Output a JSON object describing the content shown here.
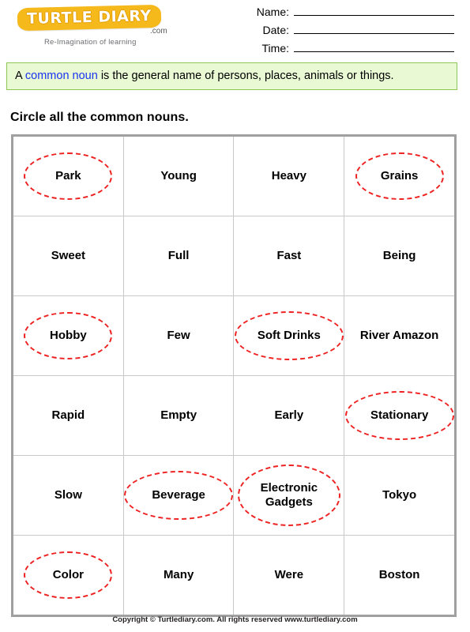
{
  "brand": {
    "logo_text": "TURTLE DIARY",
    "logo_suffix": ".com",
    "tagline": "Re-Imagination of learning",
    "badge_color": "#f6b91b",
    "badge_outline_color": "#e39c00"
  },
  "header_fields": [
    {
      "label": "Name:"
    },
    {
      "label": "Date:"
    },
    {
      "label": "Time:"
    }
  ],
  "definition": {
    "lead": "A ",
    "keyword": "common noun",
    "rest": " is the general name of persons, places, animals or things.",
    "keyword_color": "#1a33f0",
    "background_color": "#e9f9d4",
    "border_color": "#8fc656"
  },
  "instruction": {
    "text": "Circle all the common nouns."
  },
  "grid": {
    "columns": 4,
    "rows": 6,
    "circle_color": "#ee2222",
    "border_color": "#a0a0a0",
    "cells": [
      [
        {
          "word": "Park",
          "circled": true,
          "shape": "one-line"
        },
        {
          "word": "Young",
          "circled": false,
          "shape": "one-line"
        },
        {
          "word": "Heavy",
          "circled": false,
          "shape": "one-line"
        },
        {
          "word": "Grains",
          "circled": true,
          "shape": "one-line"
        }
      ],
      [
        {
          "word": "Sweet",
          "circled": false,
          "shape": "one-line"
        },
        {
          "word": "Full",
          "circled": false,
          "shape": "one-line"
        },
        {
          "word": "Fast",
          "circled": false,
          "shape": "one-line"
        },
        {
          "word": "Being",
          "circled": false,
          "shape": "one-line"
        }
      ],
      [
        {
          "word": "Hobby",
          "circled": true,
          "shape": "one-line"
        },
        {
          "word": "Few",
          "circled": false,
          "shape": "one-line"
        },
        {
          "word": "Soft Drinks",
          "circled": true,
          "shape": "wide"
        },
        {
          "word": "River Amazon",
          "circled": false,
          "shape": "one-line"
        }
      ],
      [
        {
          "word": "Rapid",
          "circled": false,
          "shape": "one-line"
        },
        {
          "word": "Empty",
          "circled": false,
          "shape": "one-line"
        },
        {
          "word": "Early",
          "circled": false,
          "shape": "one-line"
        },
        {
          "word": "Stationary",
          "circled": true,
          "shape": "wide"
        }
      ],
      [
        {
          "word": "Slow",
          "circled": false,
          "shape": "one-line"
        },
        {
          "word": "Beverage",
          "circled": true,
          "shape": "wide"
        },
        {
          "word": "Electronic\nGadgets",
          "circled": true,
          "shape": "two-line"
        },
        {
          "word": "Tokyo",
          "circled": false,
          "shape": "one-line"
        }
      ],
      [
        {
          "word": "Color",
          "circled": true,
          "shape": "one-line"
        },
        {
          "word": "Many",
          "circled": false,
          "shape": "one-line"
        },
        {
          "word": "Were",
          "circled": false,
          "shape": "one-line"
        },
        {
          "word": "Boston",
          "circled": false,
          "shape": "one-line"
        }
      ]
    ]
  },
  "footer": {
    "text": "Copyright © Turtlediary.com. All rights reserved www.turtlediary.com"
  }
}
